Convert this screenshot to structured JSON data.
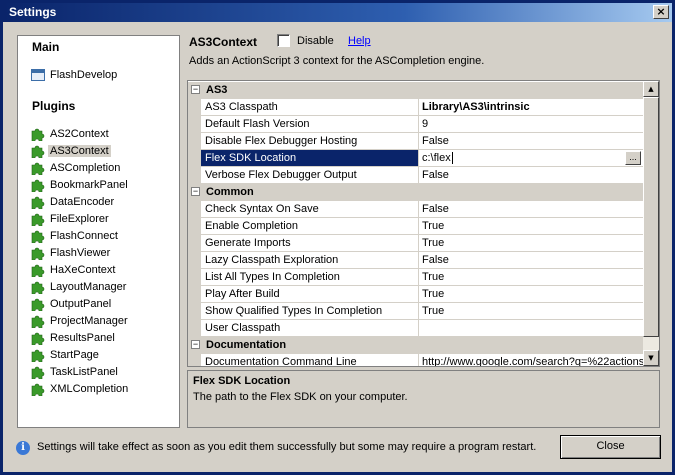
{
  "window": {
    "title": "Settings",
    "close_glyph": "×"
  },
  "left": {
    "main_header": "Main",
    "main_items": [
      {
        "label": "FlashDevelop",
        "icon": "flashdevelop-icon"
      }
    ],
    "plugins_header": "Plugins",
    "plugins": [
      "AS2Context",
      "AS3Context",
      "ASCompletion",
      "BookmarkPanel",
      "DataEncoder",
      "FileExplorer",
      "FlashConnect",
      "FlashViewer",
      "HaXeContext",
      "LayoutManager",
      "OutputPanel",
      "ProjectManager",
      "ResultsPanel",
      "StartPage",
      "TaskListPanel",
      "XMLCompletion"
    ],
    "selected_plugin": "AS3Context"
  },
  "plugin": {
    "name": "AS3Context",
    "disable_label": "Disable",
    "disable_checked": false,
    "help_label": "Help",
    "description": "Adds an ActionScript 3 context for the ASCompletion engine."
  },
  "grid": {
    "categories": [
      {
        "name": "AS3",
        "toggle": "−",
        "properties": [
          {
            "name": "AS3 Classpath",
            "value": "Library\\AS3\\intrinsic",
            "bold": true
          },
          {
            "name": "Default Flash Version",
            "value": "9"
          },
          {
            "name": "Disable Flex Debugger Hosting",
            "value": "False"
          },
          {
            "name": "Flex SDK Location",
            "value": "c:\\flex",
            "selected": true,
            "editing": true
          },
          {
            "name": "Verbose Flex Debugger Output",
            "value": "False"
          }
        ]
      },
      {
        "name": "Common",
        "toggle": "−",
        "properties": [
          {
            "name": "Check Syntax On Save",
            "value": "False"
          },
          {
            "name": "Enable Completion",
            "value": "True"
          },
          {
            "name": "Generate Imports",
            "value": "True"
          },
          {
            "name": "Lazy Classpath Exploration",
            "value": "False"
          },
          {
            "name": "List All Types In Completion",
            "value": "True"
          },
          {
            "name": "Play After Build",
            "value": "True"
          },
          {
            "name": "Show Qualified Types In Completion",
            "value": "True"
          },
          {
            "name": "User Classpath",
            "value": ""
          }
        ]
      },
      {
        "name": "Documentation",
        "toggle": "−",
        "properties": [
          {
            "name": "Documentation Command Line",
            "value": "http://www.google.com/search?q=%22actions"
          }
        ]
      }
    ],
    "ellipsis_label": "..."
  },
  "help": {
    "title": "Flex SDK Location",
    "description": "The path to the Flex SDK on your computer."
  },
  "footer": {
    "info_text": "Settings will take effect as soon as you edit them successfully but some may require a program restart.",
    "close_label": "Close"
  },
  "colors": {
    "title_bar": "#0a246a",
    "selection": "#0a246a",
    "face": "#d4d0c8",
    "link": "#0000ff",
    "plugin_icon": "#3a9a2a"
  }
}
